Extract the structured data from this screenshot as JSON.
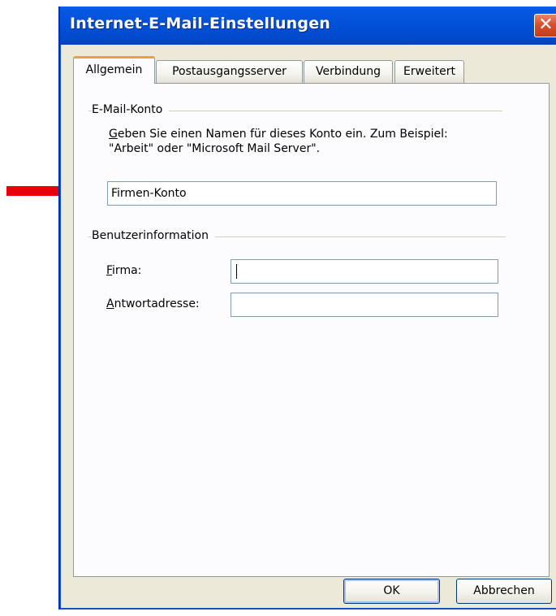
{
  "window": {
    "title": "Internet-E-Mail-Einstellungen",
    "close_glyph": "✕"
  },
  "tabs": [
    {
      "label": "Allgemein",
      "active": true
    },
    {
      "label": "Postausgangsserver",
      "active": false
    },
    {
      "label": "Verbindung",
      "active": false
    },
    {
      "label": "Erweitert",
      "active": false
    }
  ],
  "email_account": {
    "group_label": "E-Mail-Konto",
    "description_line1": "Geben Sie einen Namen für dieses Konto ein. Zum Beispiel:",
    "description_line2": "\"Arbeit\" oder \"Microsoft Mail Server\".",
    "account_name_value": "Firmen-Konto"
  },
  "user_info": {
    "group_label": "Benutzerinformation",
    "company_label": "Firma:",
    "company_value": "",
    "reply_label": "Antwortadresse:",
    "reply_value": ""
  },
  "buttons": {
    "ok": "OK",
    "cancel": "Abbrechen"
  },
  "annotation": {
    "arrow_color": "#e8000b"
  },
  "colors": {
    "titlebar": "#0250d8",
    "dialog_bg": "#ece9d8",
    "active_tab_accent": "#e7a433"
  }
}
